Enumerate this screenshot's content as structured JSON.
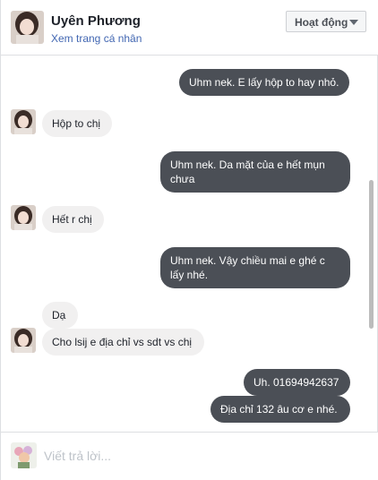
{
  "header": {
    "name": "Uyên Phương",
    "profile_link": "Xem trang cá nhân",
    "activity_button": "Hoạt động"
  },
  "messages": [
    {
      "side": "out",
      "text": "Uhm nek. E lấy hộp to hay nhỏ."
    },
    {
      "side": "in",
      "text": "Hộp to chị"
    },
    {
      "side": "out",
      "text": "Uhm nek. Da mặt của e hết mụn chưa"
    },
    {
      "side": "in",
      "text": "Hết r chị"
    },
    {
      "side": "out",
      "text": "Uhm nek. Vậy chiều mai e ghé c lấy nhé."
    },
    {
      "side": "in",
      "text": "Dạ"
    },
    {
      "side": "in",
      "text": "Cho lsij e địa chỉ vs sdt vs chị"
    },
    {
      "side": "out",
      "text": "Uh. 01694942637"
    },
    {
      "side": "out",
      "text": "Địa chỉ 132 âu cơ e nhé."
    }
  ],
  "composer": {
    "placeholder": "Viết trả lời..."
  },
  "icons": {
    "contact_avatar": "contact-avatar",
    "own_avatar": "user-avatar",
    "dropdown": "caret-down-icon"
  }
}
